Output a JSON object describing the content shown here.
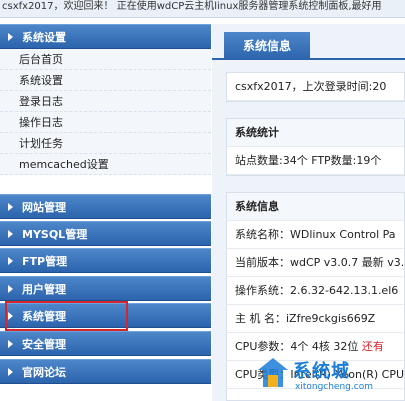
{
  "banner": {
    "text": "csxfx2017，欢迎回来！ 正在使用wdCP云主机linux服务器管理系统控制面板,最好用"
  },
  "sidebar": {
    "sections": [
      {
        "label": "系统设置",
        "items": [
          "后台首页",
          "系统设置",
          "登录日志",
          "操作日志",
          "计划任务",
          "memcached设置"
        ]
      },
      {
        "label": "网站管理"
      },
      {
        "label": "MYSQL管理"
      },
      {
        "label": "FTP管理"
      },
      {
        "label": "用户管理"
      },
      {
        "label": "系统管理"
      },
      {
        "label": "安全管理"
      },
      {
        "label": "官网论坛"
      }
    ]
  },
  "main": {
    "tab_label": "系统信息",
    "welcome": "csxfx2017，上次登录时间:20",
    "stats": {
      "title": "系统统计",
      "text": "站点数量:34个  FTP数量:19个"
    },
    "info": {
      "title": "系统信息",
      "rows": [
        "系统名称：WDlinux Control Pa",
        "当前版本：wdCP v3.0.7 最新 v3.",
        "操作系统：2.6.32-642.13.1.el6",
        "主 机 名：iZfre9ckgis669Z",
        "CPU参数：4个 4核 32位",
        "CPU类型：Intel(R) Xeon(R) CPU"
      ],
      "cpu_note": "还有"
    }
  },
  "watermark": {
    "text": "系统城",
    "url": "xitongcheng.com"
  },
  "colors": {
    "nav_blue": "#2c64ad",
    "highlight_red": "#d7262b",
    "watermark_blue": "#1a7dd7"
  }
}
